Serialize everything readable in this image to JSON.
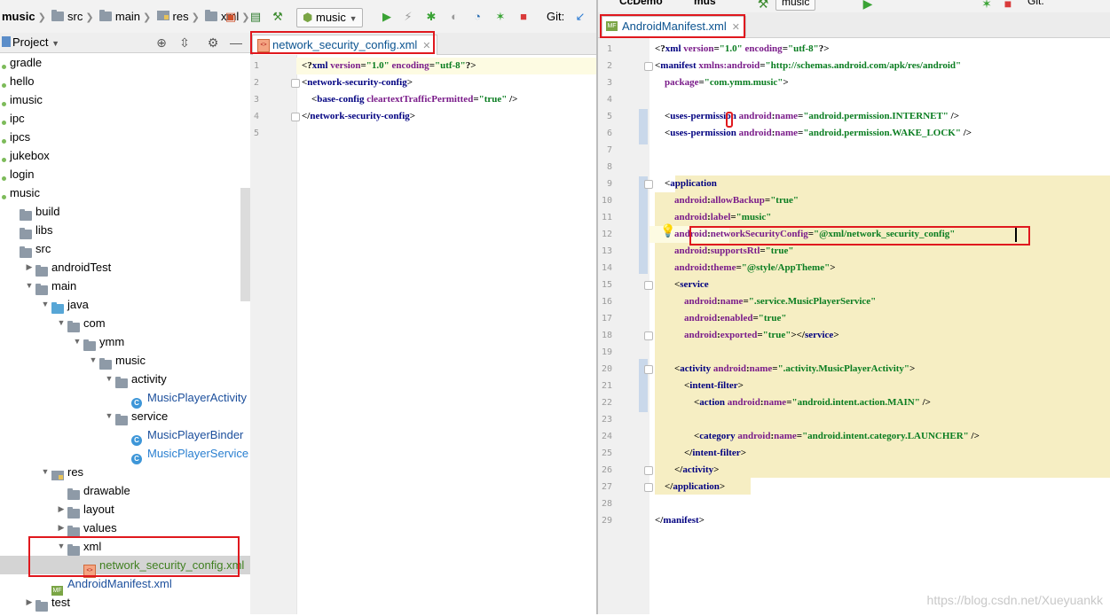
{
  "toolbar": {
    "breadcrumb": [
      "music",
      "src",
      "main",
      "res",
      "xml"
    ],
    "run_config": "music",
    "vcs_label": "Git:"
  },
  "right_toolbar": {
    "project": "CcDemo",
    "module": "mus",
    "run_config": "music",
    "vcs_label": "Git:"
  },
  "project_panel": {
    "title": "Project"
  },
  "tree": [
    {
      "label": "gradle",
      "depth": 0,
      "icon": "module",
      "arrow": ""
    },
    {
      "label": "hello",
      "depth": 0,
      "icon": "module",
      "arrow": ""
    },
    {
      "label": "imusic",
      "depth": 0,
      "icon": "module",
      "arrow": ""
    },
    {
      "label": "ipc",
      "depth": 0,
      "icon": "module",
      "arrow": ""
    },
    {
      "label": "ipcs",
      "depth": 0,
      "icon": "module",
      "arrow": ""
    },
    {
      "label": "jukebox",
      "depth": 0,
      "icon": "module",
      "arrow": ""
    },
    {
      "label": "login",
      "depth": 0,
      "icon": "module",
      "arrow": ""
    },
    {
      "label": "music",
      "depth": 0,
      "icon": "module",
      "arrow": ""
    },
    {
      "label": "build",
      "depth": 1,
      "icon": "folder",
      "arrow": ""
    },
    {
      "label": "libs",
      "depth": 1,
      "icon": "folder",
      "arrow": ""
    },
    {
      "label": "src",
      "depth": 1,
      "icon": "folder",
      "arrow": ""
    },
    {
      "label": "androidTest",
      "depth": 2,
      "icon": "folder",
      "arrow": "right"
    },
    {
      "label": "main",
      "depth": 2,
      "icon": "folder",
      "arrow": "down"
    },
    {
      "label": "java",
      "depth": 3,
      "icon": "folder-blue",
      "arrow": "down"
    },
    {
      "label": "com",
      "depth": 4,
      "icon": "package",
      "arrow": "down"
    },
    {
      "label": "ymm",
      "depth": 5,
      "icon": "package",
      "arrow": "down"
    },
    {
      "label": "music",
      "depth": 6,
      "icon": "package",
      "arrow": "down"
    },
    {
      "label": "activity",
      "depth": 7,
      "icon": "package",
      "arrow": "down"
    },
    {
      "label": "MusicPlayerActivity",
      "depth": 8,
      "icon": "class",
      "arrow": ""
    },
    {
      "label": "service",
      "depth": 7,
      "icon": "package",
      "arrow": "down"
    },
    {
      "label": "MusicPlayerBinder",
      "depth": 8,
      "icon": "class",
      "arrow": ""
    },
    {
      "label": "MusicPlayerService",
      "depth": 8,
      "icon": "class",
      "arrow": ""
    },
    {
      "label": "res",
      "depth": 3,
      "icon": "res",
      "arrow": "down"
    },
    {
      "label": "drawable",
      "depth": 4,
      "icon": "package",
      "arrow": ""
    },
    {
      "label": "layout",
      "depth": 4,
      "icon": "package",
      "arrow": "right"
    },
    {
      "label": "values",
      "depth": 4,
      "icon": "package",
      "arrow": "right"
    },
    {
      "label": "xml",
      "depth": 4,
      "icon": "package",
      "arrow": "down"
    },
    {
      "label": "network_security_config.xml",
      "depth": 5,
      "icon": "xml",
      "arrow": ""
    },
    {
      "label": "AndroidManifest.xml",
      "depth": 3,
      "icon": "manifest",
      "arrow": ""
    },
    {
      "label": "test",
      "depth": 2,
      "icon": "folder",
      "arrow": "right"
    }
  ],
  "left_editor": {
    "tab_label": "network_security_config.xml",
    "lines": [
      {
        "n": "1",
        "code": [
          [
            "p",
            "<?"
          ],
          [
            "t",
            "xml "
          ],
          [
            "a",
            "version"
          ],
          [
            "p",
            "="
          ],
          [
            "v",
            "\"1.0\" "
          ],
          [
            "a",
            "encoding"
          ],
          [
            "p",
            "="
          ],
          [
            "v",
            "\"utf-8\""
          ],
          [
            "p",
            "?>"
          ]
        ]
      },
      {
        "n": "2",
        "code": [
          [
            "p",
            "<"
          ],
          [
            "t",
            "network-security-config"
          ],
          [
            "p",
            ">"
          ]
        ]
      },
      {
        "n": "3",
        "code": [
          [
            "p",
            "    <"
          ],
          [
            "t",
            "base-config "
          ],
          [
            "a",
            "cleartextTrafficPermitted"
          ],
          [
            "p",
            "="
          ],
          [
            "v",
            "\"true\""
          ],
          [
            "p",
            " />"
          ]
        ]
      },
      {
        "n": "4",
        "code": [
          [
            "p",
            "</"
          ],
          [
            "t",
            "network-security-config"
          ],
          [
            "p",
            ">"
          ]
        ]
      },
      {
        "n": "5",
        "code": []
      }
    ]
  },
  "right_editor": {
    "tab_label": "AndroidManifest.xml",
    "lines": [
      {
        "n": "1",
        "code": [
          [
            "p",
            "<?"
          ],
          [
            "t",
            "xml "
          ],
          [
            "a",
            "version"
          ],
          [
            "p",
            "="
          ],
          [
            "v",
            "\"1.0\" "
          ],
          [
            "a",
            "encoding"
          ],
          [
            "p",
            "="
          ],
          [
            "v",
            "\"utf-8\""
          ],
          [
            "p",
            "?>"
          ]
        ]
      },
      {
        "n": "2",
        "code": [
          [
            "p",
            "<"
          ],
          [
            "t",
            "manifest "
          ],
          [
            "a",
            "xmlns:android"
          ],
          [
            "p",
            "="
          ],
          [
            "v",
            "\"http://schemas.android.com/apk/res/android\""
          ]
        ]
      },
      {
        "n": "3",
        "code": [
          [
            "p",
            "    "
          ],
          [
            "a",
            "package"
          ],
          [
            "p",
            "="
          ],
          [
            "v",
            "\"com.ymm.music\""
          ],
          [
            "p",
            ">"
          ]
        ]
      },
      {
        "n": "4",
        "code": []
      },
      {
        "n": "5",
        "code": [
          [
            "p",
            "    <"
          ],
          [
            "t",
            "uses-permission "
          ],
          [
            "a",
            "android"
          ],
          [
            "p",
            ":"
          ],
          [
            "a",
            "name"
          ],
          [
            "p",
            "="
          ],
          [
            "v",
            "\"android.permission.INTERNET\""
          ],
          [
            "p",
            " />"
          ]
        ]
      },
      {
        "n": "6",
        "code": [
          [
            "p",
            "    <"
          ],
          [
            "t",
            "uses-permission "
          ],
          [
            "a",
            "android"
          ],
          [
            "p",
            ":"
          ],
          [
            "a",
            "name"
          ],
          [
            "p",
            "="
          ],
          [
            "v",
            "\"android.permission.WAKE_LOCK\""
          ],
          [
            "p",
            " />"
          ]
        ]
      },
      {
        "n": "7",
        "code": []
      },
      {
        "n": "8",
        "code": []
      },
      {
        "n": "9",
        "code": [
          [
            "p",
            "    <"
          ],
          [
            "t",
            "application"
          ]
        ]
      },
      {
        "n": "10",
        "code": [
          [
            "p",
            "        "
          ],
          [
            "a",
            "android"
          ],
          [
            "p",
            ":"
          ],
          [
            "a",
            "allowBackup"
          ],
          [
            "p",
            "="
          ],
          [
            "v",
            "\"true\""
          ]
        ]
      },
      {
        "n": "11",
        "code": [
          [
            "p",
            "        "
          ],
          [
            "a",
            "android"
          ],
          [
            "p",
            ":"
          ],
          [
            "a",
            "label"
          ],
          [
            "p",
            "="
          ],
          [
            "v",
            "\"music\""
          ]
        ]
      },
      {
        "n": "12",
        "code": [
          [
            "p",
            "        "
          ],
          [
            "a",
            "android"
          ],
          [
            "p",
            ":"
          ],
          [
            "a",
            "networkSecurityConfig"
          ],
          [
            "p",
            "="
          ],
          [
            "v",
            "\"@xml/network_security_config\""
          ]
        ]
      },
      {
        "n": "13",
        "code": [
          [
            "p",
            "        "
          ],
          [
            "a",
            "android"
          ],
          [
            "p",
            ":"
          ],
          [
            "a",
            "supportsRtl"
          ],
          [
            "p",
            "="
          ],
          [
            "v",
            "\"true\""
          ]
        ]
      },
      {
        "n": "14",
        "code": [
          [
            "p",
            "        "
          ],
          [
            "a",
            "android"
          ],
          [
            "p",
            ":"
          ],
          [
            "a",
            "theme"
          ],
          [
            "p",
            "="
          ],
          [
            "v",
            "\"@style/AppTheme\""
          ],
          [
            "p",
            ">"
          ]
        ]
      },
      {
        "n": "15",
        "code": [
          [
            "p",
            "        <"
          ],
          [
            "t",
            "service"
          ]
        ]
      },
      {
        "n": "16",
        "code": [
          [
            "p",
            "            "
          ],
          [
            "a",
            "android"
          ],
          [
            "p",
            ":"
          ],
          [
            "a",
            "name"
          ],
          [
            "p",
            "="
          ],
          [
            "v",
            "\".service.MusicPlayerService\""
          ]
        ]
      },
      {
        "n": "17",
        "code": [
          [
            "p",
            "            "
          ],
          [
            "a",
            "android"
          ],
          [
            "p",
            ":"
          ],
          [
            "a",
            "enabled"
          ],
          [
            "p",
            "="
          ],
          [
            "v",
            "\"true\""
          ]
        ]
      },
      {
        "n": "18",
        "code": [
          [
            "p",
            "            "
          ],
          [
            "a",
            "android"
          ],
          [
            "p",
            ":"
          ],
          [
            "a",
            "exported"
          ],
          [
            "p",
            "="
          ],
          [
            "v",
            "\"true\""
          ],
          [
            "p",
            "></"
          ],
          [
            "t",
            "service"
          ],
          [
            "p",
            ">"
          ]
        ]
      },
      {
        "n": "19",
        "code": []
      },
      {
        "n": "20",
        "code": [
          [
            "p",
            "        <"
          ],
          [
            "t",
            "activity "
          ],
          [
            "a",
            "android"
          ],
          [
            "p",
            ":"
          ],
          [
            "a",
            "name"
          ],
          [
            "p",
            "="
          ],
          [
            "v",
            "\".activity.MusicPlayerActivity\""
          ],
          [
            "p",
            ">"
          ]
        ]
      },
      {
        "n": "21",
        "code": [
          [
            "p",
            "            <"
          ],
          [
            "t",
            "intent-filter"
          ],
          [
            "p",
            ">"
          ]
        ]
      },
      {
        "n": "22",
        "code": [
          [
            "p",
            "                <"
          ],
          [
            "t",
            "action "
          ],
          [
            "a",
            "android"
          ],
          [
            "p",
            ":"
          ],
          [
            "a",
            "name"
          ],
          [
            "p",
            "="
          ],
          [
            "v",
            "\"android.intent.action.MAIN\""
          ],
          [
            "p",
            " />"
          ]
        ]
      },
      {
        "n": "23",
        "code": []
      },
      {
        "n": "24",
        "code": [
          [
            "p",
            "                <"
          ],
          [
            "t",
            "category "
          ],
          [
            "a",
            "android"
          ],
          [
            "p",
            ":"
          ],
          [
            "a",
            "name"
          ],
          [
            "p",
            "="
          ],
          [
            "v",
            "\"android.intent.category.LAUNCHER\""
          ],
          [
            "p",
            " />"
          ]
        ]
      },
      {
        "n": "25",
        "code": [
          [
            "p",
            "            </"
          ],
          [
            "t",
            "intent-filter"
          ],
          [
            "p",
            ">"
          ]
        ]
      },
      {
        "n": "26",
        "code": [
          [
            "p",
            "        </"
          ],
          [
            "t",
            "activity"
          ],
          [
            "p",
            ">"
          ]
        ]
      },
      {
        "n": "27",
        "code": [
          [
            "p",
            "    </"
          ],
          [
            "t",
            "application"
          ],
          [
            "p",
            ">"
          ]
        ]
      },
      {
        "n": "28",
        "code": []
      },
      {
        "n": "29",
        "code": [
          [
            "p",
            "</"
          ],
          [
            "t",
            "manifest"
          ],
          [
            "p",
            ">"
          ]
        ]
      }
    ]
  },
  "watermark": "https://blog.csdn.net/Xueyuankk",
  "colors": {
    "highlight_box": "#e0181e",
    "application_block": "#f6eec3",
    "current_line": "#fdfbe2",
    "tag": "#000080",
    "attribute": "#7a1c8a",
    "value": "#0a7d21"
  }
}
